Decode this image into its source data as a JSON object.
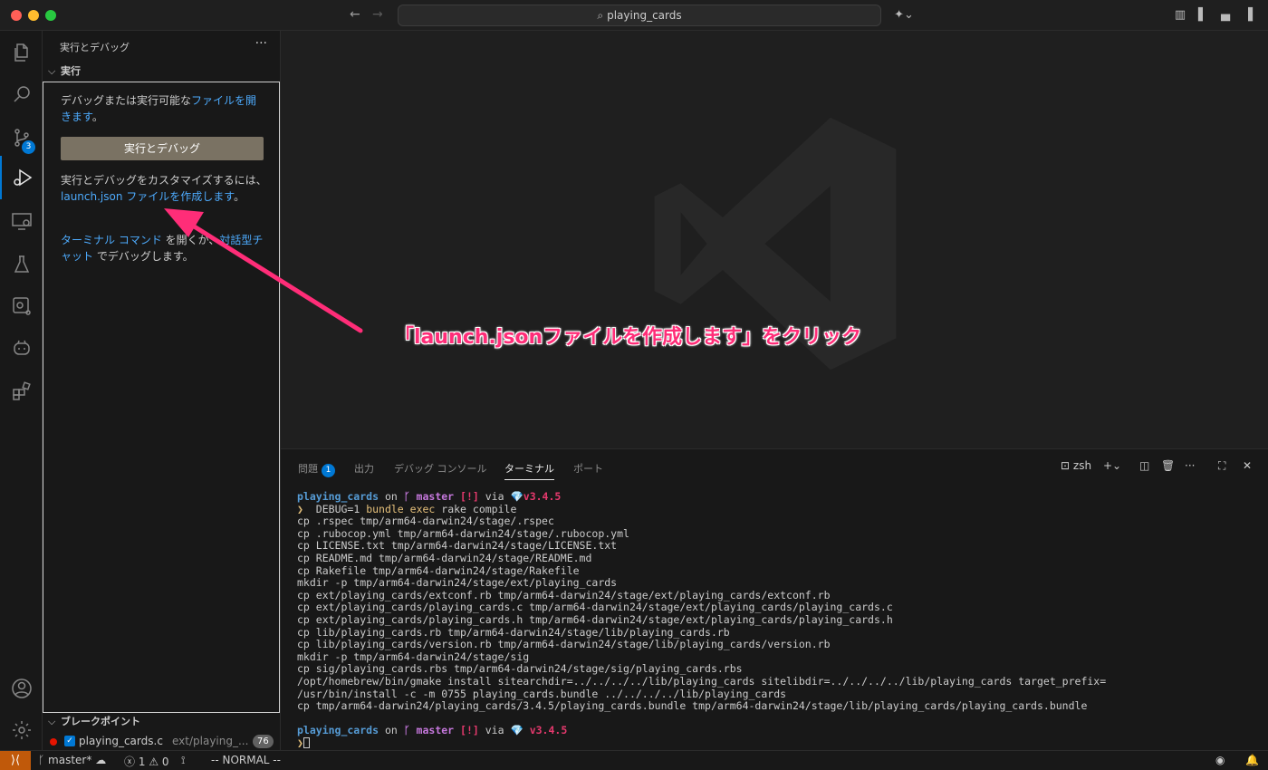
{
  "titlebar": {
    "search_text": "playing_cards",
    "back_icon": "arrow-left-icon",
    "forward_icon": "arrow-right-icon"
  },
  "activity_bar": {
    "items": [
      "explorer-icon",
      "search-icon",
      "source-control-icon",
      "run-debug-icon",
      "remote-explorer-icon",
      "testing-icon",
      "github-actions-icon",
      "copilot-icon",
      "extensions-icon"
    ],
    "source_control_badge": "3",
    "bottom_items": [
      "account-icon",
      "settings-gear-icon"
    ]
  },
  "sidebar": {
    "title": "実行とデバッグ",
    "more": "···",
    "section_run": "実行",
    "open_file_text": "デバッグまたは実行可能な",
    "open_file_link": "ファイルを開きます",
    "open_file_suffix": "。",
    "run_button": "実行とデバッグ",
    "customize_text": "実行とデバッグをカスタマイズするには、",
    "customize_link": "launch.json ファイルを作成します",
    "customize_suffix": "。",
    "terminal_link": "ターミナル コマンド",
    "terminal_mid": " を開くか、",
    "chat_link": "対話型チャット",
    "chat_suffix": " でデバッグします。",
    "section_breakpoints": "ブレークポイント",
    "breakpoint": {
      "file": "playing_cards.c",
      "path": "ext/playing_...",
      "line": "76"
    }
  },
  "annotation": "「launch.jsonファイルを作成します」をクリック",
  "panel": {
    "tabs": [
      {
        "label": "問題",
        "badge": "1"
      },
      {
        "label": "出力"
      },
      {
        "label": "デバッグ コンソール"
      },
      {
        "label": "ターミナル",
        "active": true
      },
      {
        "label": "ポート"
      }
    ],
    "shell": "zsh",
    "prompt": {
      "dir": "playing_cards",
      "on": " on ",
      "branch": "master",
      "status": "[!]",
      "via": " via ",
      "ruby": "v3.4.5"
    },
    "command_prefix": "DEBUG=1 ",
    "command_highlight": "bundle exec",
    "command_rest": " rake compile",
    "output": [
      "cp .rspec tmp/arm64-darwin24/stage/.rspec",
      "cp .rubocop.yml tmp/arm64-darwin24/stage/.rubocop.yml",
      "cp LICENSE.txt tmp/arm64-darwin24/stage/LICENSE.txt",
      "cp README.md tmp/arm64-darwin24/stage/README.md",
      "cp Rakefile tmp/arm64-darwin24/stage/Rakefile",
      "mkdir -p tmp/arm64-darwin24/stage/ext/playing_cards",
      "cp ext/playing_cards/extconf.rb tmp/arm64-darwin24/stage/ext/playing_cards/extconf.rb",
      "cp ext/playing_cards/playing_cards.c tmp/arm64-darwin24/stage/ext/playing_cards/playing_cards.c",
      "cp ext/playing_cards/playing_cards.h tmp/arm64-darwin24/stage/ext/playing_cards/playing_cards.h",
      "cp lib/playing_cards.rb tmp/arm64-darwin24/stage/lib/playing_cards.rb",
      "cp lib/playing_cards/version.rb tmp/arm64-darwin24/stage/lib/playing_cards/version.rb",
      "mkdir -p tmp/arm64-darwin24/stage/sig",
      "cp sig/playing_cards.rbs tmp/arm64-darwin24/stage/sig/playing_cards.rbs",
      "/opt/homebrew/bin/gmake install sitearchdir=../../../../lib/playing_cards sitelibdir=../../../../lib/playing_cards target_prefix=",
      "/usr/bin/install -c -m 0755 playing_cards.bundle ../../../../lib/playing_cards",
      "cp tmp/arm64-darwin24/playing_cards/3.4.5/playing_cards.bundle tmp/arm64-darwin24/stage/lib/playing_cards/playing_cards.bundle"
    ]
  },
  "statusbar": {
    "branch": "master*",
    "errors": "1",
    "warnings": "0",
    "mode": "-- NORMAL --"
  }
}
